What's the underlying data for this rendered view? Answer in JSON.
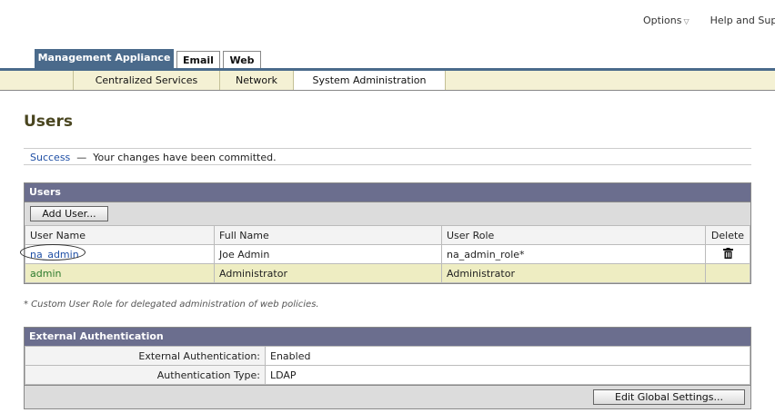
{
  "header": {
    "options_label": "Options",
    "help_label": "Help and Supp"
  },
  "tabs": [
    {
      "label": "Management Appliance",
      "active": true
    },
    {
      "label": "Email",
      "active": false
    },
    {
      "label": "Web",
      "active": false
    }
  ],
  "subnav": [
    {
      "label": "Centralized Services"
    },
    {
      "label": "Network"
    },
    {
      "label": "System Administration",
      "active": true
    }
  ],
  "page": {
    "title": "Users",
    "message": {
      "status": "Success",
      "dash": "—",
      "text": "Your changes have been committed."
    },
    "footnote": "* Custom User Role for delegated administration of web policies."
  },
  "users_panel": {
    "title": "Users",
    "add_button": "Add User...",
    "columns": [
      "User Name",
      "Full Name",
      "User Role",
      "Delete"
    ],
    "rows": [
      {
        "username": "na_admin",
        "fullname": "Joe Admin",
        "role": "na_admin_role*",
        "deletable": true
      },
      {
        "username": "admin",
        "fullname": "Administrator",
        "role": "Administrator",
        "deletable": false
      }
    ]
  },
  "ext_auth_panel": {
    "title": "External Authentication",
    "rows": [
      {
        "label": "External Authentication:",
        "value": "Enabled"
      },
      {
        "label": "Authentication Type:",
        "value": "LDAP"
      }
    ],
    "edit_button": "Edit Global Settings..."
  },
  "colors": {
    "tab_active": "#4a6a8b",
    "panel_header": "#6b6e8e",
    "subnav_bg": "#f4f1d4",
    "row_highlight": "#eeedc2",
    "link": "#1f4fa5",
    "title": "#4a4620"
  }
}
